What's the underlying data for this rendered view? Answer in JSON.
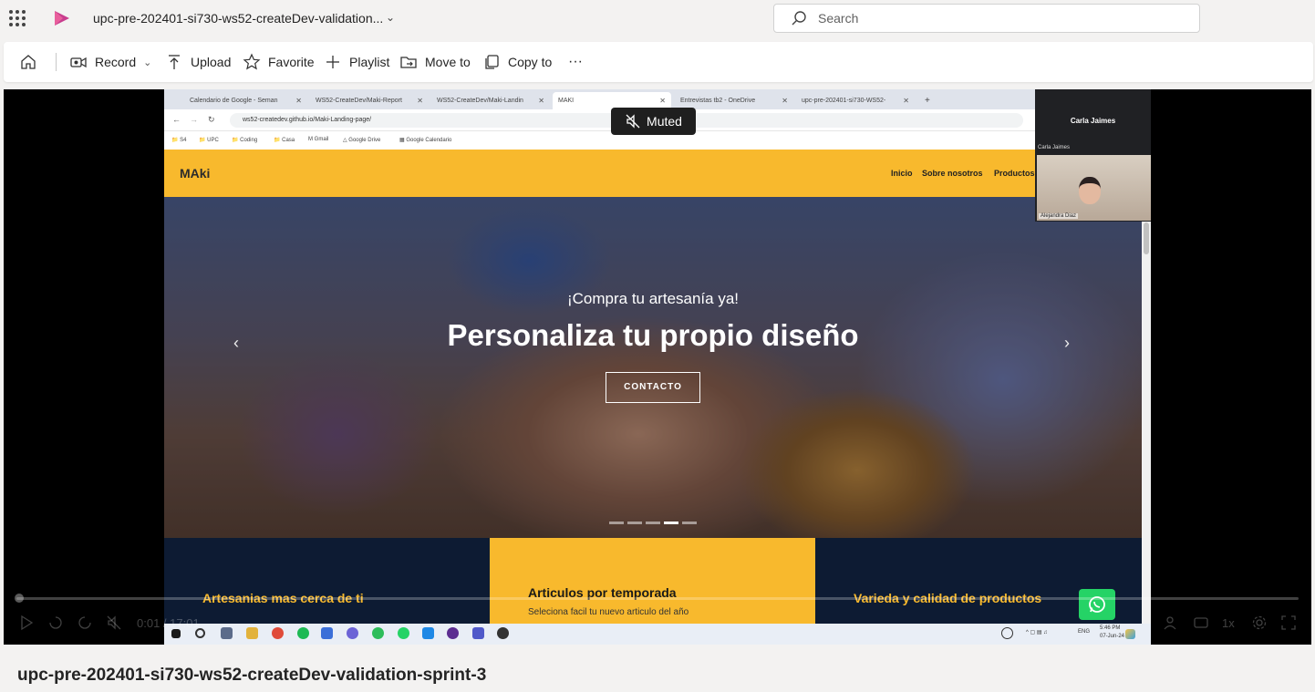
{
  "topbar": {
    "app_launcher_icon": "waffle-icon",
    "app_icon": "stream-logo",
    "doc_title": "upc-pre-202401-si730-ws52-createDev-validation...",
    "search_placeholder": "Search"
  },
  "commands": {
    "home_icon": "home-icon",
    "record": "Record",
    "upload": "Upload",
    "favorite": "Favorite",
    "playlist": "Playlist",
    "move_to": "Move to",
    "copy_to": "Copy to",
    "more": "···"
  },
  "video": {
    "muted_label": "Muted",
    "time": "0:01 / 17:01",
    "speed": "1x",
    "progress": 0.001,
    "title": "upc-pre-202401-si730-ws52-createDev-validation-sprint-3"
  },
  "browser": {
    "tabs": [
      "Calendario de Google - Seman",
      "WS52-CreateDev/Maki-Report",
      "WS52-CreateDev/Maki-Landin",
      "MAKI",
      "Entrevistas tb2 - OneDrive",
      "upc-pre-202401-si730-WS52-"
    ],
    "url": "ws52-createdev.github.io/Maki-Landing-page/",
    "bookmarks": [
      "S4",
      "UPC",
      "Coding",
      "Casa",
      "Gmail",
      "Google Drive",
      "Google Calendario"
    ]
  },
  "site": {
    "logo": "MAki",
    "nav": [
      "Inicio",
      "Sobre nosotros",
      "Productos"
    ],
    "hero_subtitle": "¡Compra tu artesanía ya!",
    "hero_title": "Personaliza tu propio diseño",
    "hero_button": "CONTACTO",
    "features": [
      {
        "title": "Artesanias mas cerca de ti"
      },
      {
        "title": "Articulos por temporada",
        "subtitle": "Seleciona facil tu nuevo articulo del año"
      },
      {
        "title": "Varieda y calidad de productos"
      }
    ]
  },
  "participants": {
    "main": "Carla Jaimes",
    "label": "Carla Jaimes",
    "camera_label": "Alejandra Diaz"
  },
  "taskbar": {
    "lang": "ENG",
    "time": "5:46 PM",
    "date": "07-Jun-24"
  }
}
